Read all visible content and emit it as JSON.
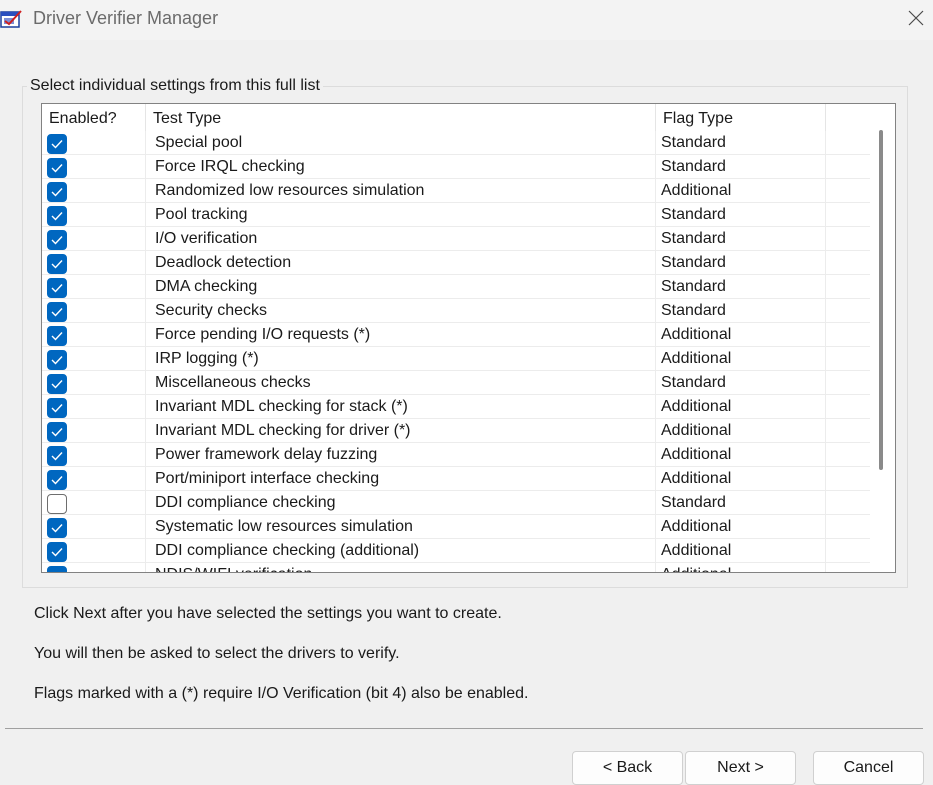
{
  "window": {
    "title": "Driver Verifier Manager"
  },
  "group": {
    "label": "Select individual settings from this full list"
  },
  "table": {
    "columns": [
      "Enabled?",
      "Test Type",
      "Flag Type"
    ],
    "rows": [
      {
        "enabled": true,
        "test": "Special pool",
        "flag": "Standard"
      },
      {
        "enabled": true,
        "test": "Force IRQL checking",
        "flag": "Standard"
      },
      {
        "enabled": true,
        "test": "Randomized low resources simulation",
        "flag": "Additional"
      },
      {
        "enabled": true,
        "test": "Pool tracking",
        "flag": "Standard"
      },
      {
        "enabled": true,
        "test": "I/O verification",
        "flag": "Standard"
      },
      {
        "enabled": true,
        "test": "Deadlock detection",
        "flag": "Standard"
      },
      {
        "enabled": true,
        "test": "DMA checking",
        "flag": "Standard"
      },
      {
        "enabled": true,
        "test": "Security checks",
        "flag": "Standard"
      },
      {
        "enabled": true,
        "test": "Force pending I/O requests (*)",
        "flag": "Additional"
      },
      {
        "enabled": true,
        "test": "IRP logging (*)",
        "flag": "Additional"
      },
      {
        "enabled": true,
        "test": "Miscellaneous checks",
        "flag": "Standard"
      },
      {
        "enabled": true,
        "test": "Invariant MDL checking for stack (*)",
        "flag": "Additional"
      },
      {
        "enabled": true,
        "test": "Invariant MDL checking for driver (*)",
        "flag": "Additional"
      },
      {
        "enabled": true,
        "test": "Power framework delay fuzzing",
        "flag": "Additional"
      },
      {
        "enabled": true,
        "test": "Port/miniport interface checking",
        "flag": "Additional"
      },
      {
        "enabled": false,
        "test": "DDI compliance checking",
        "flag": "Standard"
      },
      {
        "enabled": true,
        "test": "Systematic low resources simulation",
        "flag": "Additional"
      },
      {
        "enabled": true,
        "test": "DDI compliance checking (additional)",
        "flag": "Additional"
      },
      {
        "enabled": true,
        "test": "NDIS/WIFI verification",
        "flag": "Additional"
      }
    ]
  },
  "info": {
    "line1": "Click Next after you have selected the settings you want to create.",
    "line2": "You will then be asked to select the drivers to verify.",
    "line3": "Flags marked with a (*) require I/O Verification (bit 4) also be enabled."
  },
  "buttons": {
    "back": "< Back",
    "next": "Next >",
    "cancel": "Cancel"
  },
  "icons": {
    "app": "driver-verifier-icon",
    "close": "close-icon",
    "check": "checkmark-icon"
  },
  "colors": {
    "accent": "#0067c0",
    "background": "#f0f0f0"
  }
}
